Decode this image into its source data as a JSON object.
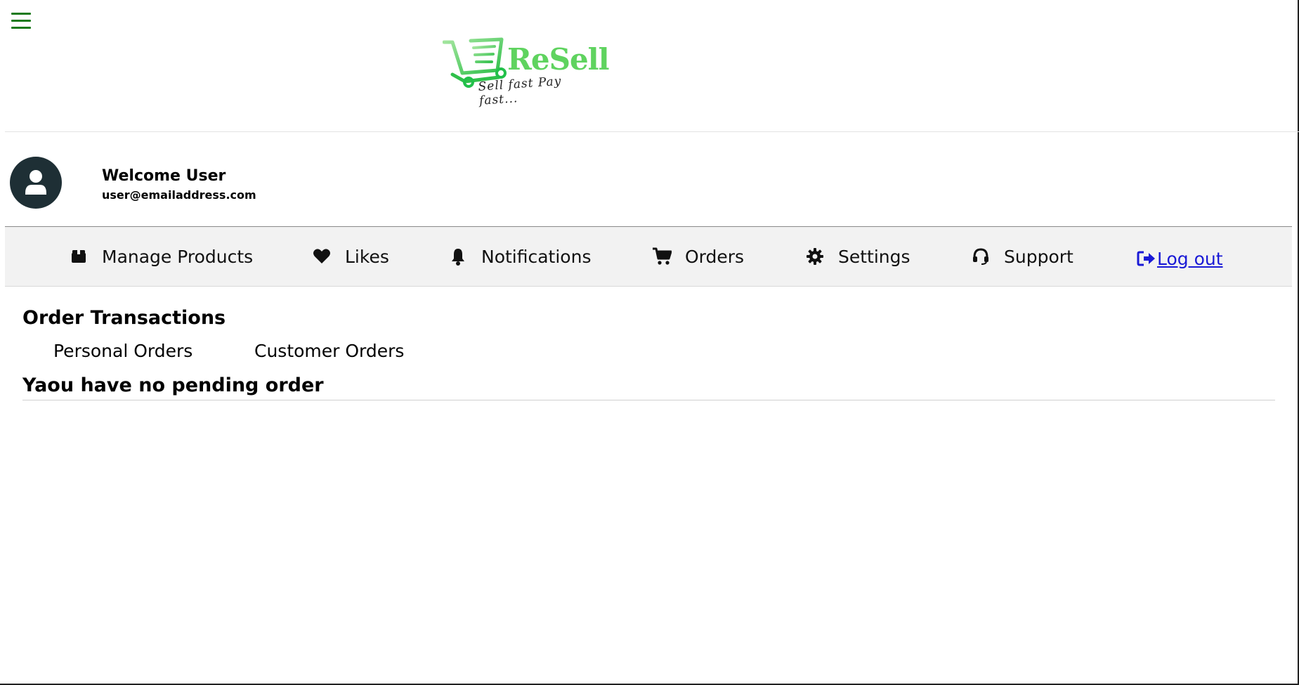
{
  "header": {
    "menu_icon": "hamburger-icon",
    "logo": {
      "brand": "ReSell",
      "tagline": "Sell fast Pay fast...",
      "color": "#5fd35f"
    }
  },
  "profile": {
    "avatar_icon": "user-icon",
    "welcome": "Welcome User",
    "email": "user@emailaddress.com"
  },
  "nav": {
    "items": [
      {
        "label": "Manage Products",
        "icon": "box-icon"
      },
      {
        "label": "Likes",
        "icon": "heart-icon"
      },
      {
        "label": "Notifications",
        "icon": "bell-icon"
      },
      {
        "label": "Orders",
        "icon": "cart-icon"
      },
      {
        "label": "Settings",
        "icon": "gear-icon"
      },
      {
        "label": "Support",
        "icon": "headset-icon"
      }
    ],
    "logout": {
      "label": " Log out",
      "icon": "sign-out-icon",
      "color": "#1a1ad6"
    }
  },
  "main": {
    "title": "Order Transactions",
    "tabs": [
      {
        "label": "Personal Orders"
      },
      {
        "label": "Customer Orders"
      }
    ],
    "empty_message": "Yaou have no pending order"
  }
}
